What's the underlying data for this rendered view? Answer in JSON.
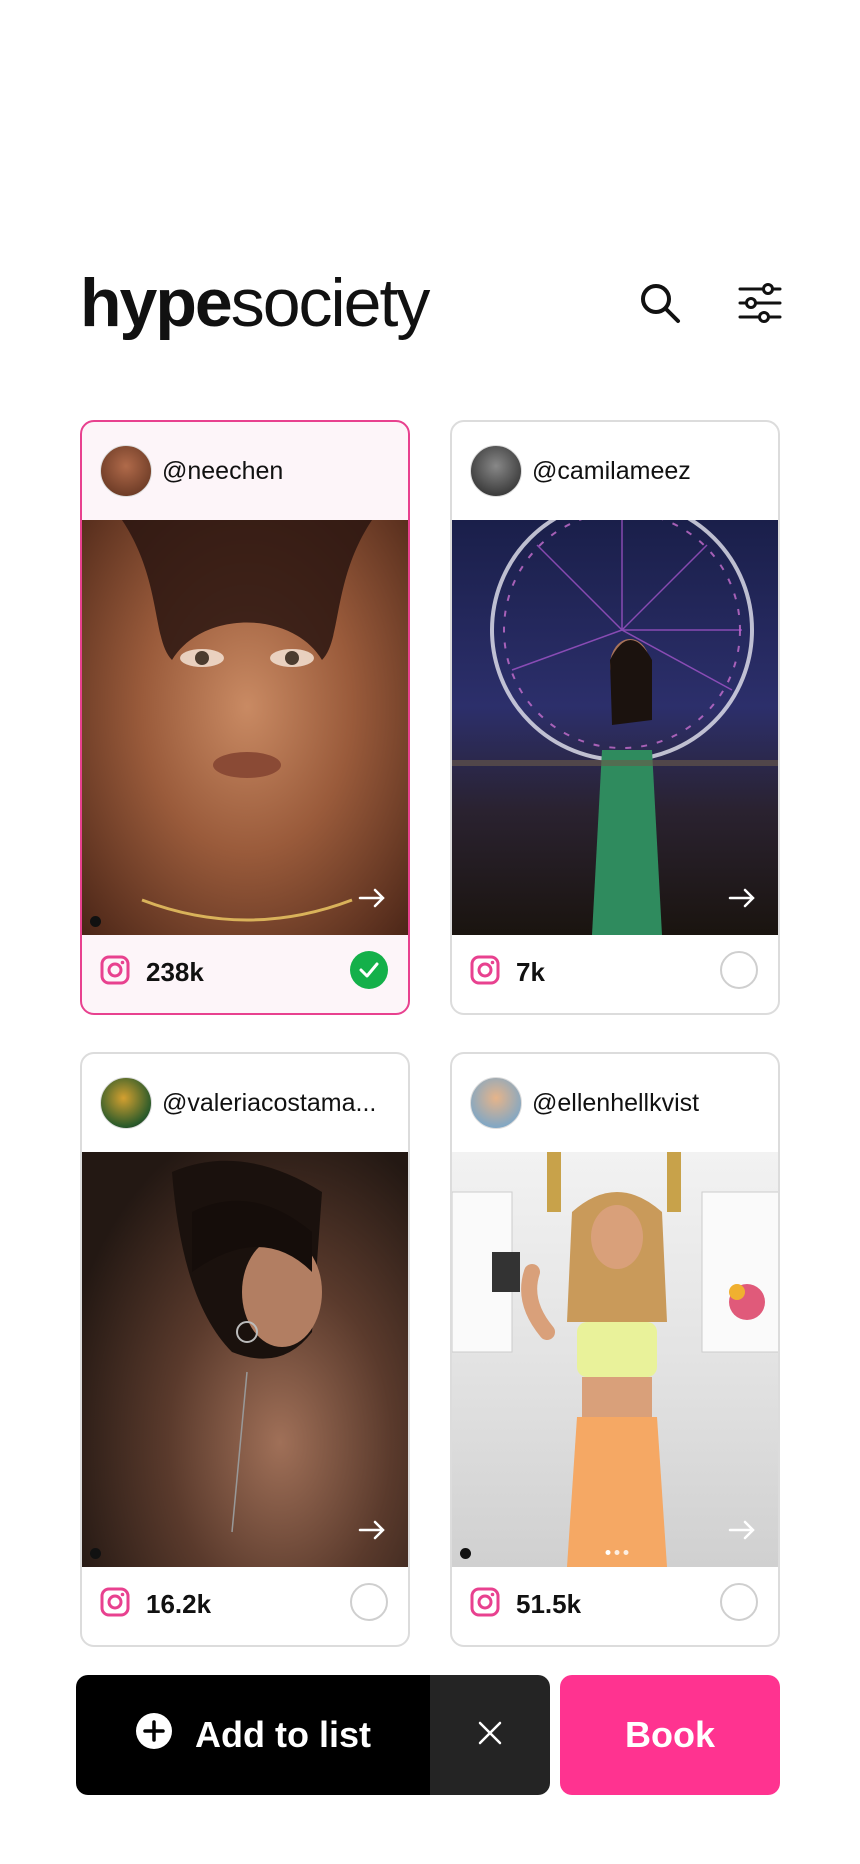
{
  "header": {
    "logo_bold": "hype",
    "logo_light": "society",
    "search_icon": "search-icon",
    "filter_icon": "sliders-icon"
  },
  "cards": [
    {
      "handle": "@neechen",
      "followers": "238k",
      "platform": "instagram",
      "selected": true,
      "image_desc": "close-up beauty portrait"
    },
    {
      "handle": "@camilameez",
      "followers": "7k",
      "platform": "instagram",
      "selected": false,
      "image_desc": "night ferris wheel, green dress"
    },
    {
      "handle": "@valeriacostama...",
      "followers": "16.2k",
      "platform": "instagram",
      "selected": false,
      "image_desc": "dark portrait, bare back"
    },
    {
      "handle": "@ellenhellkvist",
      "followers": "51.5k",
      "platform": "instagram",
      "selected": false,
      "image_desc": "kitchen, workout outfit"
    }
  ],
  "actions": {
    "add_to_list_label": "Add to list",
    "book_label": "Book"
  },
  "colors": {
    "accent_pink": "#ff3390",
    "selected_border": "#e8418f",
    "check_green": "#14b04a",
    "instagram_pink": "#e8418f"
  }
}
